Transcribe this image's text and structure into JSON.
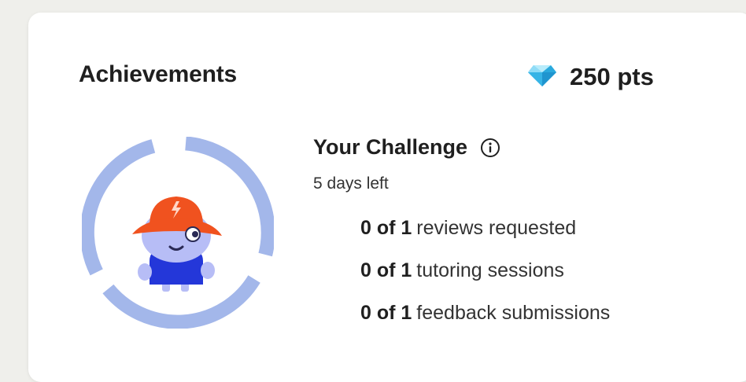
{
  "card": {
    "title": "Achievements",
    "points": {
      "value": "250 pts",
      "icon": "diamond-icon"
    }
  },
  "challenge": {
    "title": "Your Challenge",
    "info_icon": "info-icon",
    "days_left": "5 days left",
    "progress_fraction": 0,
    "tasks": [
      {
        "count": "0 of 1",
        "label": "reviews requested"
      },
      {
        "count": "0 of 1",
        "label": "tutoring sessions"
      },
      {
        "count": "0 of 1",
        "label": "feedback submissions"
      }
    ]
  },
  "colors": {
    "ring": "#a3b7ea",
    "hat": "#f0521f",
    "shirt": "#2437d9",
    "character": "#b7bdf6",
    "diamond": "#4fc3ef"
  }
}
